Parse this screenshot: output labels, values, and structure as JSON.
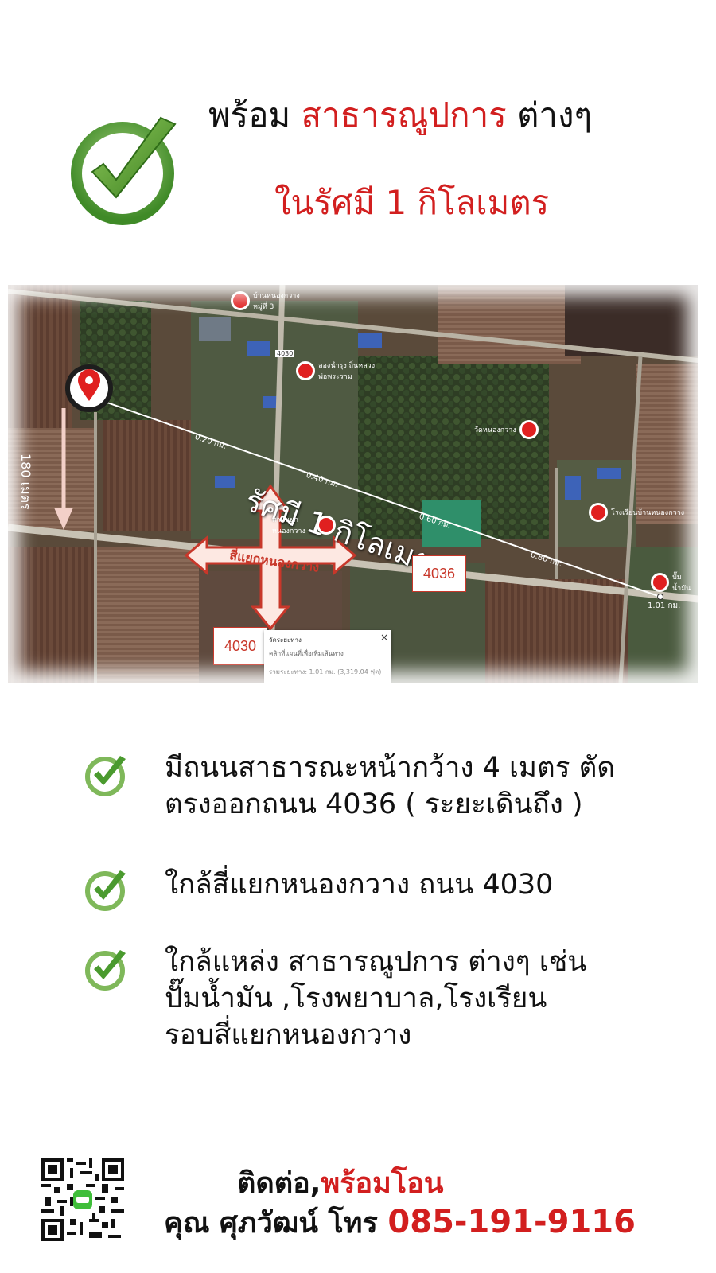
{
  "header": {
    "line1_prefix": "พร้อม",
    "line1_highlight": "สาธารณูปการ",
    "line1_suffix": "ต่างๆ",
    "line2": "ในรัศมี 1 กิโลเมตร"
  },
  "colors": {
    "accent_red": "#d21f1f",
    "check_green": "#4a9a2e",
    "check_ring": "#8bbf6a"
  },
  "map": {
    "radius_label": "รัศมี 1 กิโลเมตร",
    "distance_label": "180 เมตร",
    "intersection_label": "สี่แยกหนองกวาง",
    "road_4036": "4036",
    "road_4030": "4030",
    "road_badge_small": "4030",
    "distance_marks": [
      "0.20 กม.",
      "0.40 กม.",
      "0.60 กม.",
      "0.80 กม.",
      "1.01 กม."
    ],
    "places": [
      {
        "name": "บ้านหนองกวาง หมู่ที่ 3"
      },
      {
        "name": "ลองนำรุง ถิ่นหลวงพ่อพระราม"
      },
      {
        "name": "วัดหนองกวาง"
      },
      {
        "name": "โรงเรียนบ้านหนองกวาง"
      },
      {
        "name": "สามแยกหนองกวาง"
      },
      {
        "name": "ปั๊มน้ำมัน"
      }
    ],
    "popup": {
      "title": "วัดระยะทาง",
      "hint": "คลิกที่แผนที่เพื่อเพิ่มเส้นทาง",
      "total": "รวมระยะทาง: 1.01 กม. (3,319.04 ฟุต)",
      "close": "×"
    }
  },
  "bullets": [
    {
      "icon": "check-icon",
      "lines": [
        "มีถนนสาธารณะหน้ากว้าง 4 เมตร ตัด",
        "ตรงออกถนน 4036 ( ระยะเดินถึง )"
      ]
    },
    {
      "icon": "check-icon",
      "lines": [
        "ใกล้สี่แยกหนองกวาง ถนน 4030"
      ]
    },
    {
      "icon": "check-icon",
      "lines": [
        "ใกล้แหล่ง สาธารณูปการ ต่างๆ เช่น",
        "ปั๊มน้ำมัน ,โรงพยาบาล,โรงเรียน",
        "รอบสี่แยกหนองกวาง"
      ]
    }
  ],
  "contact": {
    "label_black": "ติดต่อ,",
    "label_red": "พร้อมโอน",
    "name": "คุณ ศุภวัฒน์ โทร",
    "phone": "085-191-9116",
    "qr_icon": "line-qr-code"
  }
}
